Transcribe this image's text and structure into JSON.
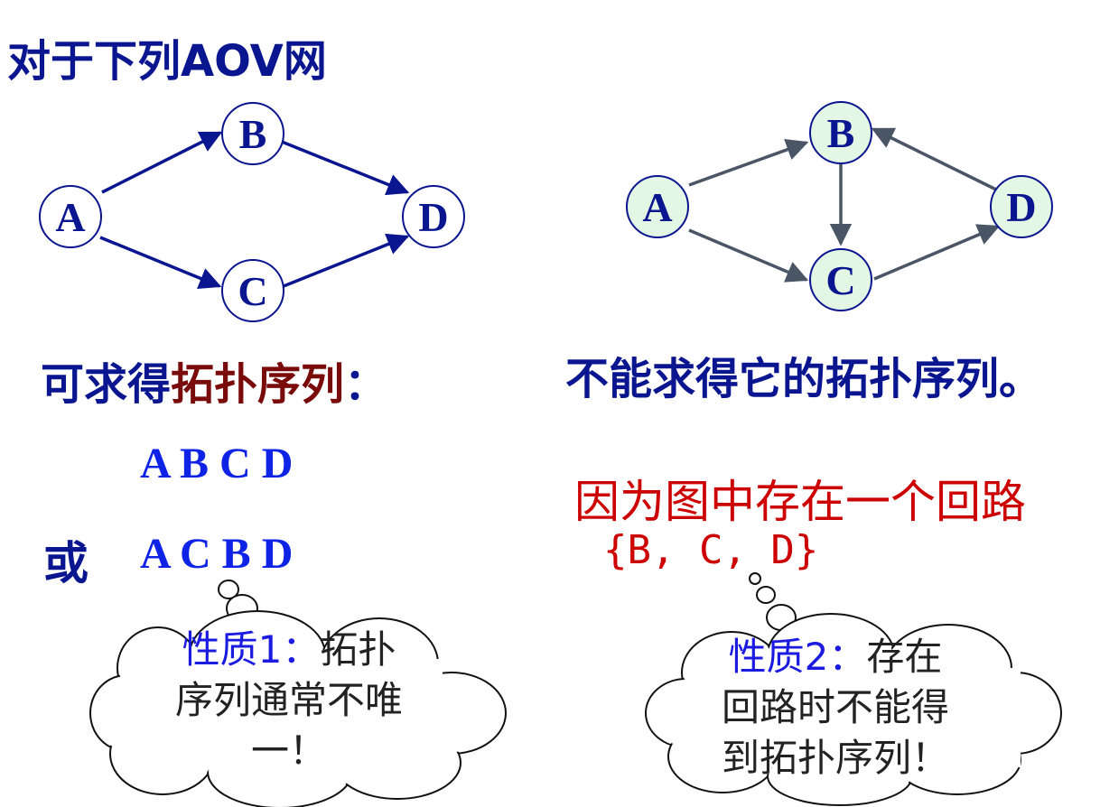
{
  "heading": "对于下列AOV网",
  "graph_left": {
    "nodes": [
      "A",
      "B",
      "C",
      "D"
    ]
  },
  "graph_right": {
    "nodes": [
      "A",
      "B",
      "C",
      "D"
    ]
  },
  "left_caption": {
    "prefix": "可求得",
    "highlight": "拓扑序列",
    "suffix": "："
  },
  "sequence_1": "A B C D",
  "or_label": "或",
  "sequence_2": "A C B D",
  "right_caption": "不能求得它的拓扑序列。",
  "reason": "因为图中存在一个回路",
  "cycle": "{B, C, D}",
  "property_1": {
    "tag": "性质1：",
    "lines": [
      "拓扑",
      "序列通常不唯",
      "一！"
    ]
  },
  "property_2": {
    "tag": "性质2：",
    "lines": [
      "存在",
      "回路时不能得",
      "到拓扑序列！"
    ]
  },
  "colors": {
    "dark_blue": "#0a1590",
    "bright_blue": "#0f23e6",
    "red": "#cc0000",
    "dark_red": "#7a0b0b",
    "node_fill_right": "#e4f7e4"
  }
}
